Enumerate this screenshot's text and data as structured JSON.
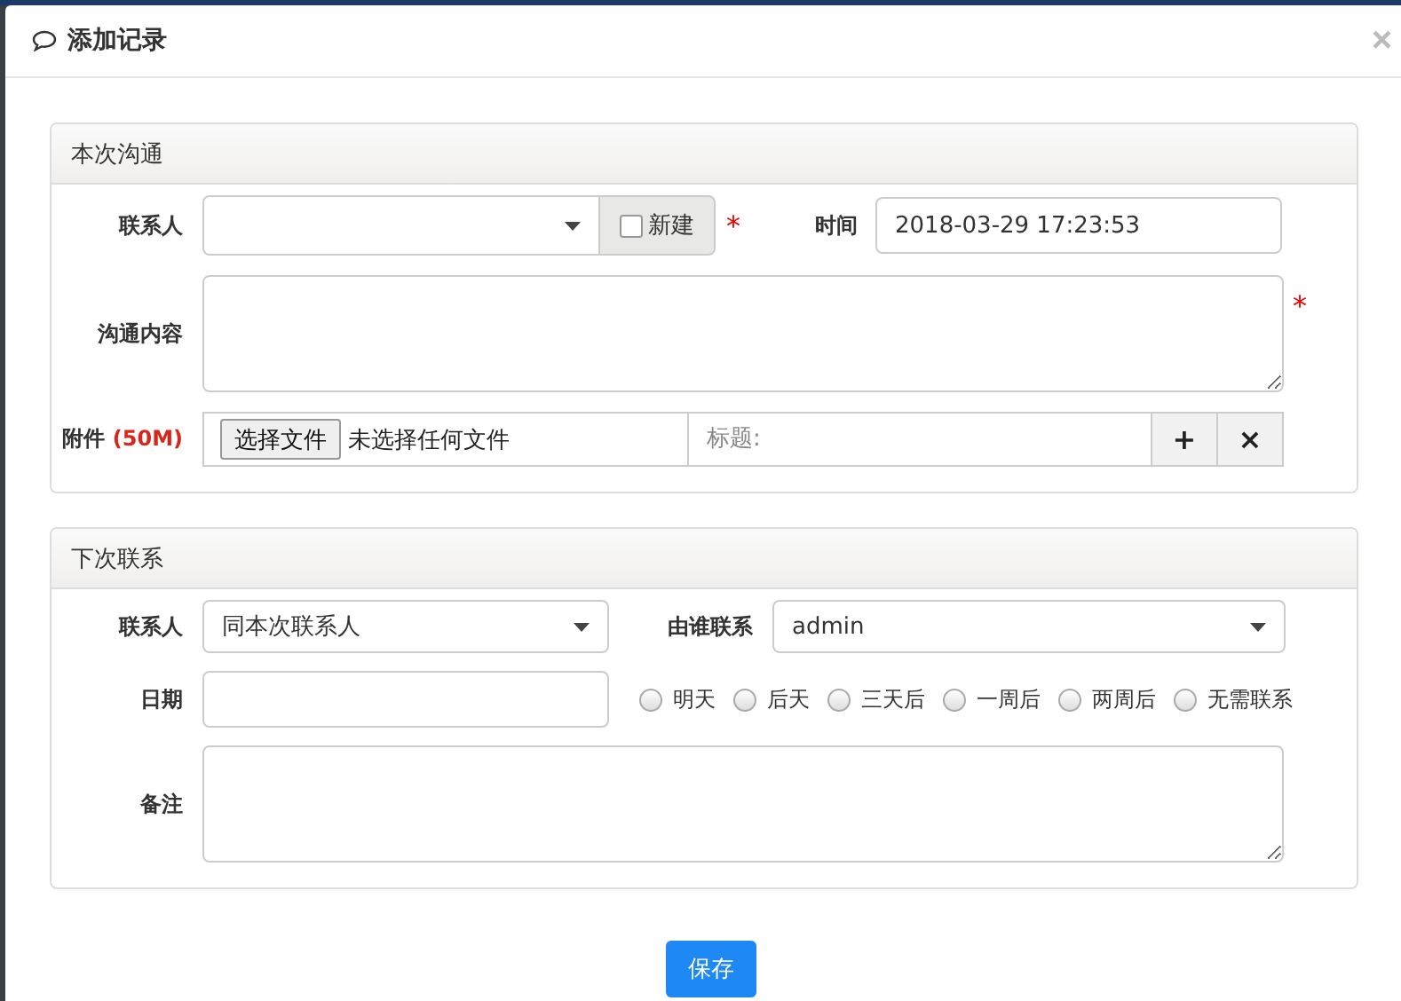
{
  "dialog": {
    "title": "添加记录",
    "close": "×"
  },
  "current": {
    "heading": "本次沟通",
    "contact": {
      "label": "联系人",
      "new_label": "新建",
      "new_checked": false,
      "required": "*"
    },
    "time": {
      "label": "时间",
      "value": "2018-03-29 17:23:53"
    },
    "content": {
      "label": "沟通内容",
      "required": "*"
    },
    "attachment": {
      "label": "附件",
      "limit": "(50M)",
      "choose": "选择文件",
      "status": "未选择任何文件",
      "title_placeholder": "标题:",
      "add": "+",
      "remove": "×"
    }
  },
  "next": {
    "heading": "下次联系",
    "contact": {
      "label": "联系人",
      "value": "同本次联系人"
    },
    "by": {
      "label": "由谁联系",
      "value": "admin"
    },
    "date": {
      "label": "日期",
      "options": [
        {
          "label": "明天",
          "selected": false
        },
        {
          "label": "后天",
          "selected": false
        },
        {
          "label": "三天后",
          "selected": false
        },
        {
          "label": "一周后",
          "selected": false
        },
        {
          "label": "两周后",
          "selected": false
        },
        {
          "label": "无需联系",
          "selected": false
        }
      ]
    },
    "note": {
      "label": "备注"
    }
  },
  "save": "保存"
}
